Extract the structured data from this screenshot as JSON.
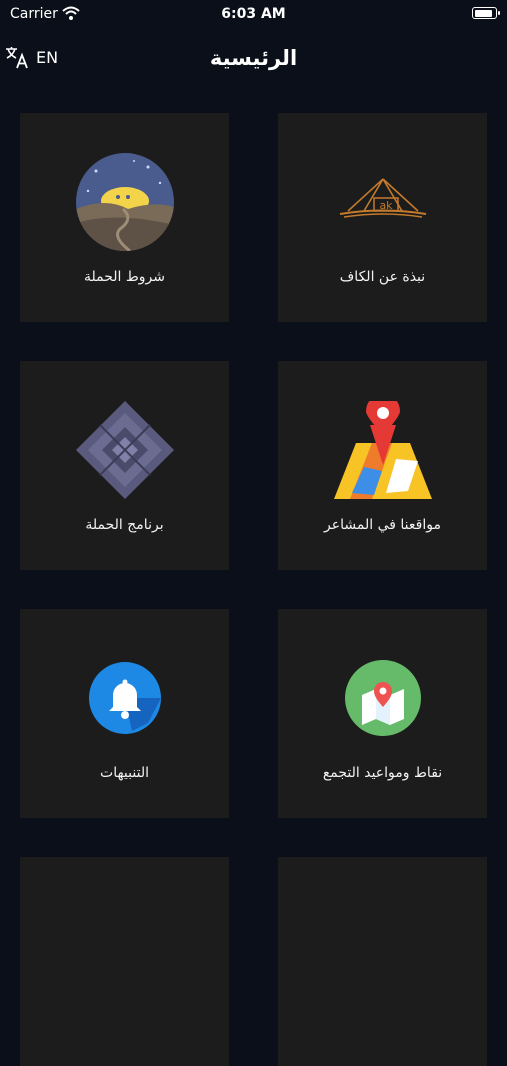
{
  "status_bar": {
    "carrier": "Carrier",
    "time": "6:03 AM",
    "battery_level": 0.9
  },
  "nav": {
    "title": "الرئيسية",
    "language_label": "EN"
  },
  "tiles": [
    {
      "label": "نبذة عن الكاف",
      "icon": "alkaf-logo-icon"
    },
    {
      "label": "شروط الحملة",
      "icon": "desert-night-moon-icon"
    },
    {
      "label": "مواقعنا في المشاعر",
      "icon": "map-pin-icon"
    },
    {
      "label": "برنامج الحملة",
      "icon": "pattern-diamond-icon"
    },
    {
      "label": "نقاط ومواعيد التجمع",
      "icon": "map-location-icon"
    },
    {
      "label": "التنبيهات",
      "icon": "bell-icon"
    }
  ],
  "colors": {
    "background": "#0b0f19",
    "tile": "#1c1c1c",
    "logo_gold": "#c47a2c",
    "pin_red": "#e53935",
    "bell_blue": "#1e88e5",
    "map_green": "#66bb6a"
  }
}
